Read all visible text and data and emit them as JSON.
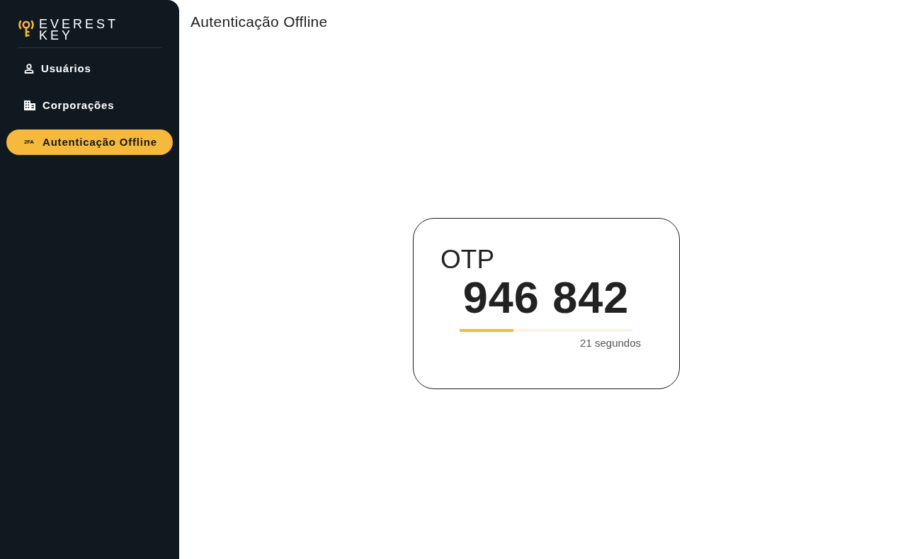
{
  "sidebar": {
    "logo": {
      "line1": "EVEREST",
      "line2": "KEY"
    },
    "items": [
      {
        "label": "Usuários",
        "selected": false
      },
      {
        "label": "Corporações",
        "selected": false
      },
      {
        "label": "Autenticação Offline",
        "selected": true,
        "icon_text": "2FA"
      }
    ]
  },
  "page": {
    "title": "Autenticação Offline"
  },
  "otp_card": {
    "heading": "OTP",
    "code": "946 842",
    "level": 0.31,
    "countdown": "21 segundos"
  }
}
